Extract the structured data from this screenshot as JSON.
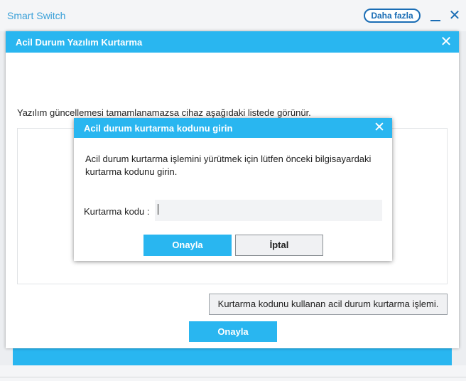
{
  "app": {
    "title": "Smart Switch",
    "more_label": "Daha fazla",
    "close_glyph": "✕"
  },
  "outer_dialog": {
    "title": "Acil Durum Yazılım Kurtarma",
    "close_glyph": "✕",
    "message": "Yazılım güncellemesi tamamlanamazsa cihaz aşağıdaki listede görünür.",
    "code_procedure_button": "Kurtarma kodunu kullanan acil durum kurtarma işlemi.",
    "confirm_label": "Onayla"
  },
  "inner_dialog": {
    "title": "Acil durum kurtarma kodunu girin",
    "close_glyph": "✕",
    "message": "Acil durum kurtarma işlemini yürütmek için lütfen önceki bilgisayardaki kurtarma kodunu girin.",
    "code_label": "Kurtarma kodu :",
    "code_value": "",
    "confirm_label": "Onayla",
    "cancel_label": "İptal"
  },
  "colors": {
    "accent": "#29b6f0",
    "brand_dark": "#1a6db5"
  }
}
